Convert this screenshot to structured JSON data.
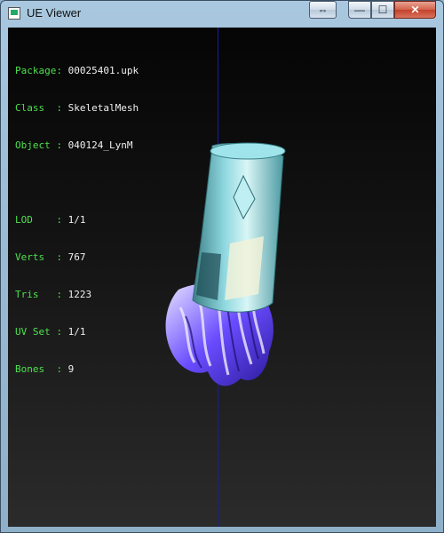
{
  "window": {
    "title": "UE Viewer",
    "buttons": {
      "swap_icon": "⇔",
      "minimize_icon": "—",
      "maximize_icon": "☐",
      "close_icon": "✕"
    }
  },
  "info": {
    "package": {
      "label": "Package:",
      "value": "00025401.upk"
    },
    "class": {
      "label": "Class  :",
      "value": "SkeletalMesh"
    },
    "object": {
      "label": "Object :",
      "value": "040124_LynM"
    },
    "lod": {
      "label": "LOD    :",
      "value": "1/1"
    },
    "verts": {
      "label": "Verts  :",
      "value": "767"
    },
    "tris": {
      "label": "Tris   :",
      "value": "1223"
    },
    "uvset": {
      "label": "UV Set :",
      "value": "1/1"
    },
    "bones": {
      "label": "Bones  :",
      "value": "9"
    }
  },
  "colors": {
    "label": "#4ee04e",
    "value": "#f0f0f0",
    "axis": "#1a1aa8",
    "mesh_glass": "#8fd8e0",
    "mesh_bristles": "#6a4cff"
  }
}
